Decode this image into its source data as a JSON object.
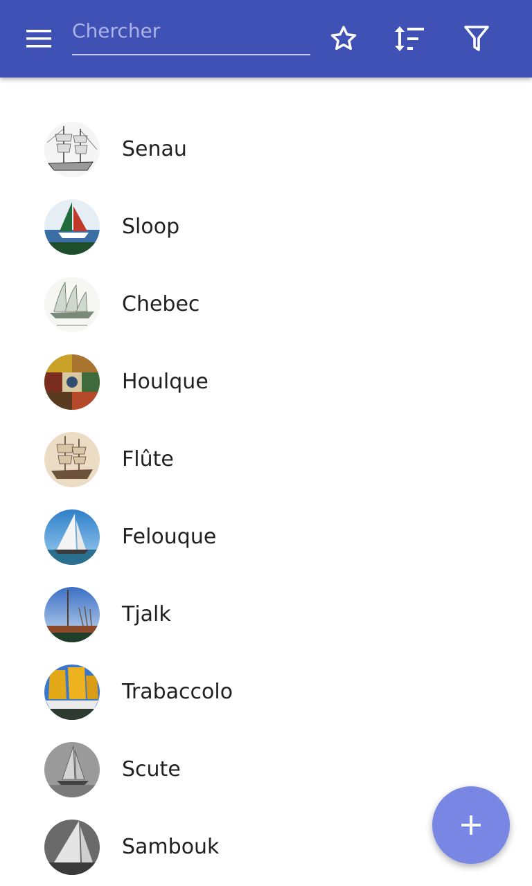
{
  "appbar": {
    "color": "#3f51b5",
    "menu_icon": "hamburger-menu-icon",
    "search_placeholder": "Chercher",
    "search_value": "",
    "favorites_icon": "star-outline-icon",
    "sort_icon": "sort-icon",
    "filter_icon": "filter-icon"
  },
  "items": [
    {
      "label": "Senau",
      "image": "sailing-ship-sketch"
    },
    {
      "label": "Sloop",
      "image": "green-sail-boat-photo"
    },
    {
      "label": "Chebec",
      "image": "lateen-ship-engraving"
    },
    {
      "label": "Houlque",
      "image": "colorful-medieval-painting"
    },
    {
      "label": "Flûte",
      "image": "sepia-ship-drawing"
    },
    {
      "label": "Felouque",
      "image": "white-sail-felucca-photo"
    },
    {
      "label": "Tjalk",
      "image": "harbor-mast-photo"
    },
    {
      "label": "Trabaccolo",
      "image": "yellow-sails-boat-photo"
    },
    {
      "label": "Scute",
      "image": "grey-sailboat-print"
    },
    {
      "label": "Sambouk",
      "image": "bw-sailboat-photo"
    }
  ],
  "fab": {
    "icon": "plus-icon",
    "color": "#7986e4"
  }
}
